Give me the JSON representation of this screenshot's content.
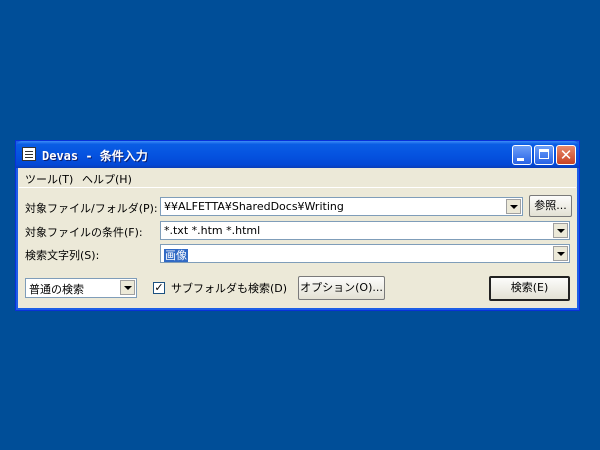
{
  "window": {
    "title": "Devas - 条件入力"
  },
  "menu": {
    "tool": "ツール(T)",
    "help": "ヘルプ(H)"
  },
  "fields": {
    "folder_label": "対象ファイル/フォルダ(P):",
    "folder_value": "¥¥ALFETTA¥SharedDocs¥Writing",
    "browse_button": "参照...",
    "condition_label": "対象ファイルの条件(F):",
    "condition_value": "*.txt *.htm *.html",
    "search_label": "検索文字列(S):",
    "search_value": "画像"
  },
  "bottom": {
    "search_mode": "普通の検索",
    "subfolder_checkbox": "✓",
    "subfolder_label": "サブフォルダも検索(D)",
    "options_button": "オプション(O)...",
    "search_button": "検索(E)"
  }
}
